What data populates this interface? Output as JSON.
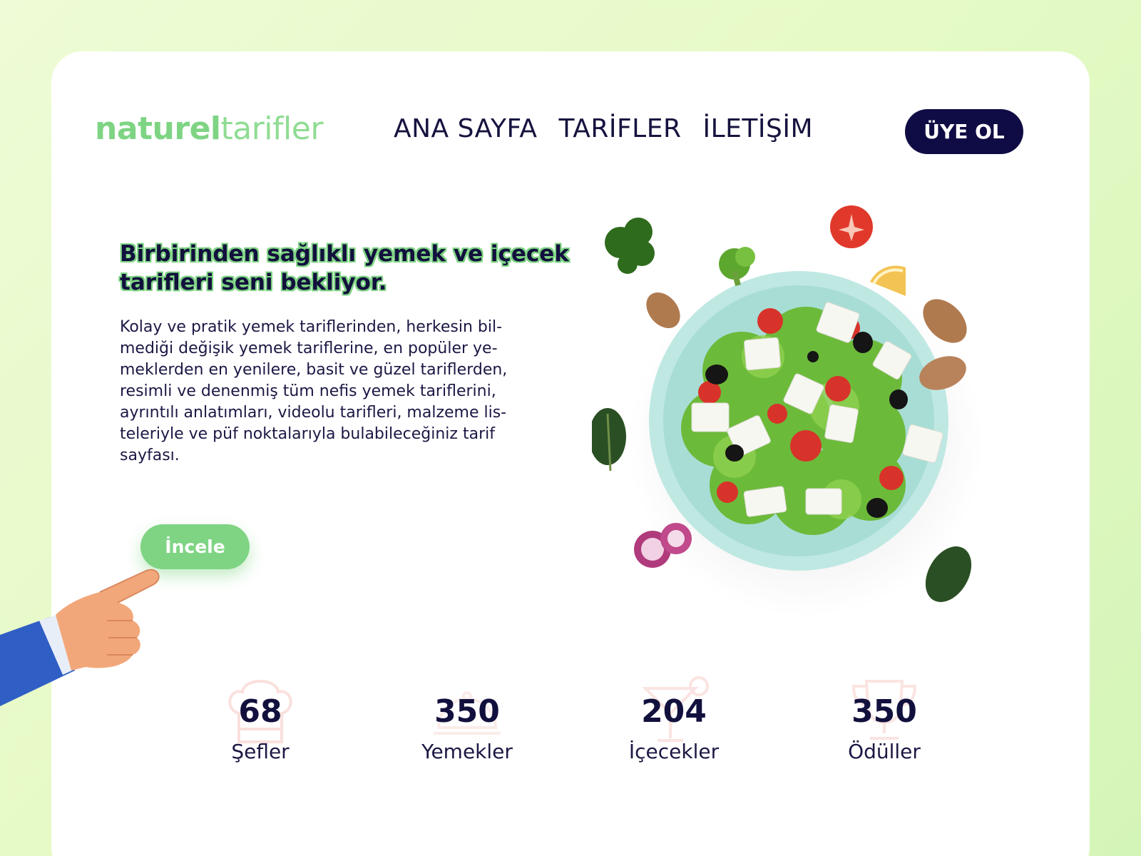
{
  "header": {
    "logo_bold": "naturel",
    "logo_light": "tarifler",
    "nav": [
      "ANA SAYFA",
      "TARİFLER",
      "İLETİŞİM"
    ],
    "signup_label": "ÜYE OL"
  },
  "hero": {
    "title": "Birbirinden sağlıklı yemek ve içecek tarifleri seni bekliyor.",
    "description_lines": [
      "Kolay ve pratik yemek tariflerinden, herkesin bil-",
      "mediği değişik yemek tariflerine, en popüler ye-",
      "meklerden en yenilere, basit ve güzel tariflerden,",
      "resimli ve denenmiş tüm nefis yemek tariflerini,",
      "ayrıntılı anlatımları, videolu tarifleri, malzeme lis-",
      "teleriyle ve püf noktalarıyla bulabileceğiniz tarif",
      "sayfası."
    ],
    "cta_label": "İncele"
  },
  "stats": [
    {
      "value": "68",
      "label": "Şefler",
      "icon": "chef-hat-icon"
    },
    {
      "value": "350",
      "label": "Yemekler",
      "icon": "food-dome-icon"
    },
    {
      "value": "204",
      "label": "İçecekler",
      "icon": "cocktail-icon"
    },
    {
      "value": "350",
      "label": "Ödüller",
      "icon": "trophy-icon"
    }
  ],
  "colors": {
    "accent_green": "#7ed483",
    "navy": "#0f0c45",
    "text": "#12103d",
    "background": "#e6fac6"
  }
}
